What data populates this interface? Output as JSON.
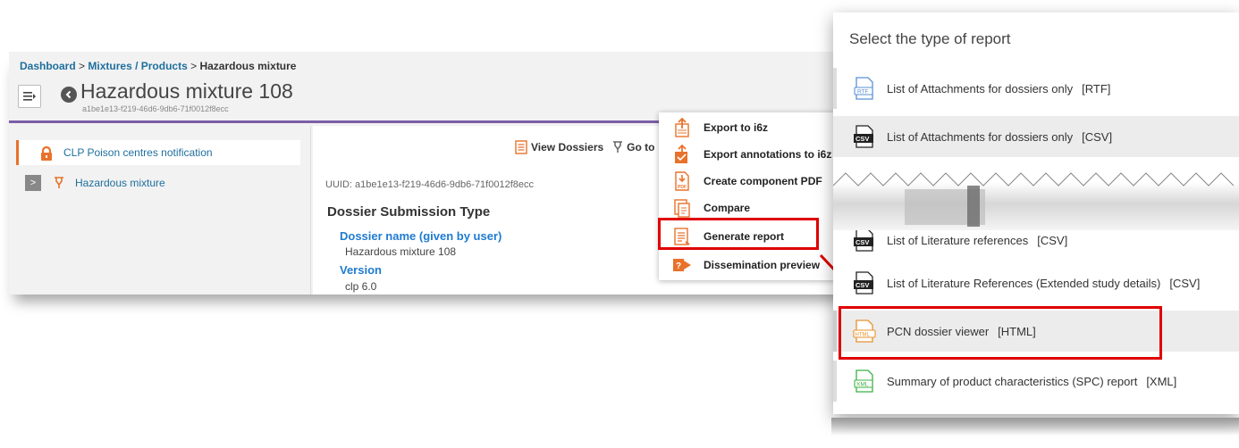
{
  "breadcrumb": {
    "items": [
      "Dashboard",
      "Mixtures / Products"
    ],
    "separator": ">",
    "current": "Hazardous mixture"
  },
  "header": {
    "title": "Hazardous mixture 108",
    "uuid": "a1be1e13-f219-46d6-9db6-71f0012f8ecc"
  },
  "sidebar": {
    "active_item": "CLP Poison centres notification",
    "tree_item": "Hazardous mixture",
    "tree_expander": ">"
  },
  "toolbar": {
    "view_dossiers": "View Dossiers",
    "go_to": "Go to"
  },
  "content": {
    "uuid_line": "UUID: a1be1e13-f219-46d6-9db6-71f0012f8ecc",
    "section_title": "Dossier Submission Type",
    "fields": [
      {
        "label": "Dossier name (given by user)",
        "value": "Hazardous mixture 108"
      },
      {
        "label": "Version",
        "value": "clp 6.0"
      }
    ]
  },
  "context_menu": {
    "items": [
      {
        "label": "Export to i6z",
        "icon": "export-i6z-icon"
      },
      {
        "label": "Export annotations to i6z",
        "icon": "export-annotations-icon"
      },
      {
        "label": "Create component PDF",
        "icon": "pdf-icon"
      },
      {
        "label": "Compare",
        "icon": "compare-icon"
      },
      {
        "label": "Generate report",
        "icon": "report-icon"
      },
      {
        "label": "Dissemination preview",
        "icon": "dissemination-icon"
      }
    ],
    "highlighted": "Generate report"
  },
  "report_dialog": {
    "title": "Select the type of report",
    "reports": [
      {
        "label": "List of Attachments for dossiers only",
        "format": "[RTF]",
        "icon": "rtf-file-icon"
      },
      {
        "label": "List of Attachments for dossiers only",
        "format": "[CSV]",
        "icon": "csv-file-icon"
      },
      {
        "label": "List of Literature references",
        "format": "[CSV]",
        "icon": "csv-file-icon"
      },
      {
        "label": "List of Literature References (Extended study details)",
        "format": "[CSV]",
        "icon": "csv-file-icon"
      },
      {
        "label": "PCN dossier viewer",
        "format": "[HTML]",
        "icon": "html-file-icon"
      },
      {
        "label": "Summary of product characteristics (SPC) report",
        "format": "[XML]",
        "icon": "xml-file-icon"
      }
    ],
    "selected": "PCN dossier viewer",
    "file_icon_labels": {
      "rtf": "RTF",
      "csv": "CSV",
      "html": "HTML",
      "xml": "XML"
    }
  },
  "colors": {
    "accent_purple": "#7b5ea7",
    "link_blue": "#1f6f9d",
    "field_blue": "#1f7bd0",
    "highlight_red": "#e00000",
    "orange": "#e8722c"
  }
}
